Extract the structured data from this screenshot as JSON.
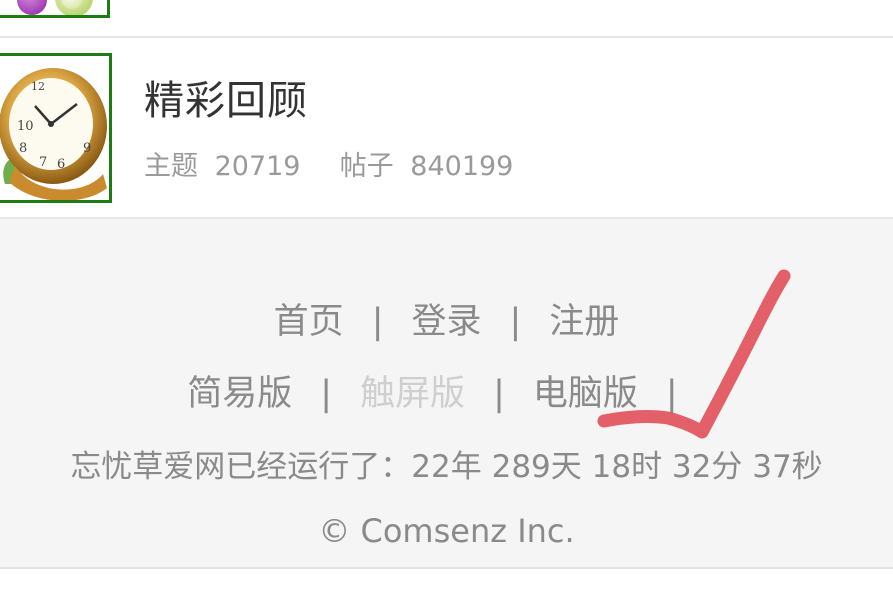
{
  "forum": {
    "title": "精彩回顾",
    "threads_label": "主题",
    "threads_count": "20719",
    "posts_label": "帖子",
    "posts_count": "840199"
  },
  "footer": {
    "nav_primary": [
      {
        "label": "首页"
      },
      {
        "label": "登录"
      },
      {
        "label": "注册"
      }
    ],
    "separator": "|",
    "nav_versions": [
      {
        "label": "简易版"
      },
      {
        "label": "触屏版"
      },
      {
        "label": "电脑版"
      }
    ],
    "runtime": "忘忧草爱网已经运行了：22年 289天 18时 32分 37秒",
    "copyright": "© Comsenz Inc."
  },
  "colors": {
    "thumb_border": "#1e7d12",
    "annotation_stroke": "#e0454f",
    "current_link": "#cfcfcf"
  },
  "icons": {
    "top_thumb": "colored-balls-icon",
    "main_thumb": "clock-icon"
  }
}
